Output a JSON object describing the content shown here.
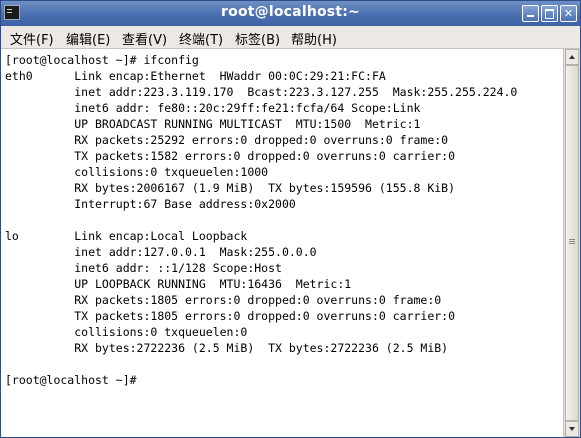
{
  "window": {
    "title": "root@localhost:~",
    "icon": "terminal-icon",
    "controls": [
      "minimize-icon",
      "maximize-icon",
      "close-icon"
    ],
    "colors": {
      "titlebar": "#4a6fb0",
      "menubar": "#ece9e4",
      "terminal_bg": "#ffffff"
    }
  },
  "menubar": {
    "items": [
      {
        "label": "文件(F)"
      },
      {
        "label": "编辑(E)"
      },
      {
        "label": "查看(V)"
      },
      {
        "label": "终端(T)"
      },
      {
        "label": "标签(B)"
      },
      {
        "label": "帮助(H)"
      }
    ]
  },
  "terminal": {
    "lines": [
      "[root@localhost ~]# ifconfig",
      "eth0      Link encap:Ethernet  HWaddr 00:0C:29:21:FC:FA",
      "          inet addr:223.3.119.170  Bcast:223.3.127.255  Mask:255.255.224.0",
      "          inet6 addr: fe80::20c:29ff:fe21:fcfa/64 Scope:Link",
      "          UP BROADCAST RUNNING MULTICAST  MTU:1500  Metric:1",
      "          RX packets:25292 errors:0 dropped:0 overruns:0 frame:0",
      "          TX packets:1582 errors:0 dropped:0 overruns:0 carrier:0",
      "          collisions:0 txqueuelen:1000",
      "          RX bytes:2006167 (1.9 MiB)  TX bytes:159596 (155.8 KiB)",
      "          Interrupt:67 Base address:0x2000",
      "",
      "lo        Link encap:Local Loopback",
      "          inet addr:127.0.0.1  Mask:255.0.0.0",
      "          inet6 addr: ::1/128 Scope:Host",
      "          UP LOOPBACK RUNNING  MTU:16436  Metric:1",
      "          RX packets:1805 errors:0 dropped:0 overruns:0 frame:0",
      "          TX packets:1805 errors:0 dropped:0 overruns:0 carrier:0",
      "          collisions:0 txqueuelen:0",
      "          RX bytes:2722236 (2.5 MiB)  TX bytes:2722236 (2.5 MiB)",
      "",
      "[root@localhost ~]#"
    ]
  }
}
